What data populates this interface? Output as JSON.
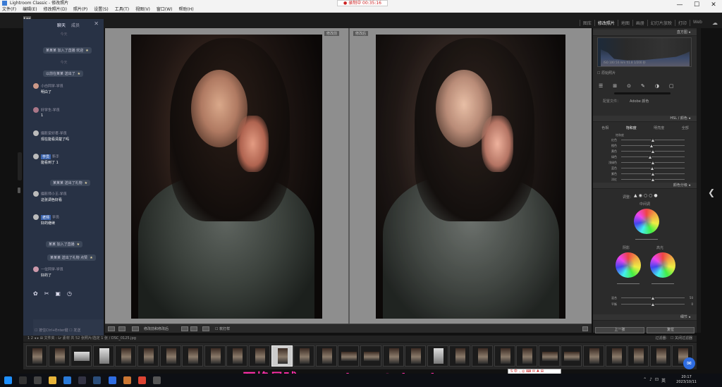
{
  "window": {
    "title": "Lightroom Classic - 修改照片",
    "minimize": "—",
    "maximize": "☐",
    "close": "✕",
    "recording_badge": "● 录制中 00:35:16"
  },
  "menu": [
    "文件(F)",
    "编辑(E)",
    "修改照片(D)",
    "照片(P)",
    "设置(S)",
    "工具(T)",
    "视图(V)",
    "窗口(W)",
    "帮助(H)"
  ],
  "lr": {
    "logo": "Lrc",
    "modules": [
      "图库",
      "修改照片",
      "地图",
      "画册",
      "幻灯片放映",
      "打印",
      "Web"
    ],
    "active_module": "修改照片",
    "cloud": "☁"
  },
  "chat": {
    "tabs": [
      "聊天",
      "成员"
    ],
    "close": "✕",
    "subtitle": "今天",
    "pills": [
      {
        "text": "某某某 加入了直播 欢迎"
      },
      {
        "text": "以前在某某 送出了"
      },
      {
        "text": "某某某 送出了礼物"
      },
      {
        "text": "某某 加入了直播"
      },
      {
        "text": "某某某 送出了礼物 点赞"
      }
    ],
    "mid_label": "今天",
    "messages": [
      {
        "name": "小白同学-学员",
        "text": "明白了"
      },
      {
        "name": "好学生-学员",
        "text": "1"
      },
      {
        "name": "摄影爱好者-学员",
        "text": "现在能看清楚了吗"
      },
      {
        "name": "新手",
        "tag": "学员",
        "text": "能看到了 1"
      },
      {
        "name": "摄影师小王-学员",
        "text": "这张调色好看"
      },
      {
        "name": "学员",
        "tag": "老师",
        "text": "好的继续"
      },
      {
        "name": "一位同学-学员",
        "text": "好的了"
      }
    ],
    "icons": [
      "✿",
      "✂",
      "▣",
      "◷"
    ],
    "footer": "☐ 按住Ctrl+Enter键 ☐ 发送"
  },
  "view": {
    "before_label": "修改前",
    "after_label": "修改后"
  },
  "toolbar": {
    "compare_text": "修改前和修改后",
    "soft_proof": "☐ 软打样"
  },
  "right": {
    "histogram_title": "直方图 ◂",
    "hist_info": "ISO 100   50 mm   f/1.8   1/200 秒",
    "original": "☐ 原始照片",
    "tools": [
      "☰",
      "⊞",
      "⊙",
      "✎",
      "◑",
      "▢"
    ],
    "profile_label": "配置文件：",
    "profile_value": "Adobe 颜色",
    "basic_title": "HSL / 颜色 ◂",
    "hsl_tabs": [
      "色相",
      "饱和度",
      "明亮度",
      "全部"
    ],
    "hsl_active": "饱和度",
    "hsl_sub": "饱和度",
    "sliders": [
      {
        "label": "红色",
        "pos": 0.5
      },
      {
        "label": "橙色",
        "pos": 0.48
      },
      {
        "label": "黄色",
        "pos": 0.5
      },
      {
        "label": "绿色",
        "pos": 0.45
      },
      {
        "label": "浅绿色",
        "pos": 0.5
      },
      {
        "label": "蓝色",
        "pos": 0.49
      },
      {
        "label": "紫色",
        "pos": 0.5
      },
      {
        "label": "洋红",
        "pos": 0.5
      }
    ],
    "grading_title": "颜色分级 ◂",
    "grading_adjust": "调整：",
    "grading_modes": [
      "▲",
      "◉",
      "○",
      "○",
      "●"
    ],
    "midtones": "中间调",
    "shadows": "阴影",
    "highlights": "高光",
    "blend_label": "混合",
    "blend_value": "50",
    "balance_label": "平衡",
    "balance_value": "0",
    "detail_title": "细节 ◂",
    "prev_button": "上一张",
    "reset_button": "复位"
  },
  "film": {
    "head": "1  2  ◂ ▸  ⊞  文件夹 : Lr 素材  共 52 张照片/选定 1 张 /  DSC_0125.jpg",
    "filter": "过滤器：  ☐ 关闭过滤器",
    "thumbs": 30,
    "selected_index": 11
  },
  "watermark": "互换星球 www.irasutobook.com",
  "ime": "S 中 ·, ◎ ⌨ ✉ ♣ ⊞",
  "clock": {
    "time": "20:17",
    "date": "2023/10/11"
  },
  "tray": [
    "⌃",
    "♪",
    "⊡",
    "英"
  ]
}
